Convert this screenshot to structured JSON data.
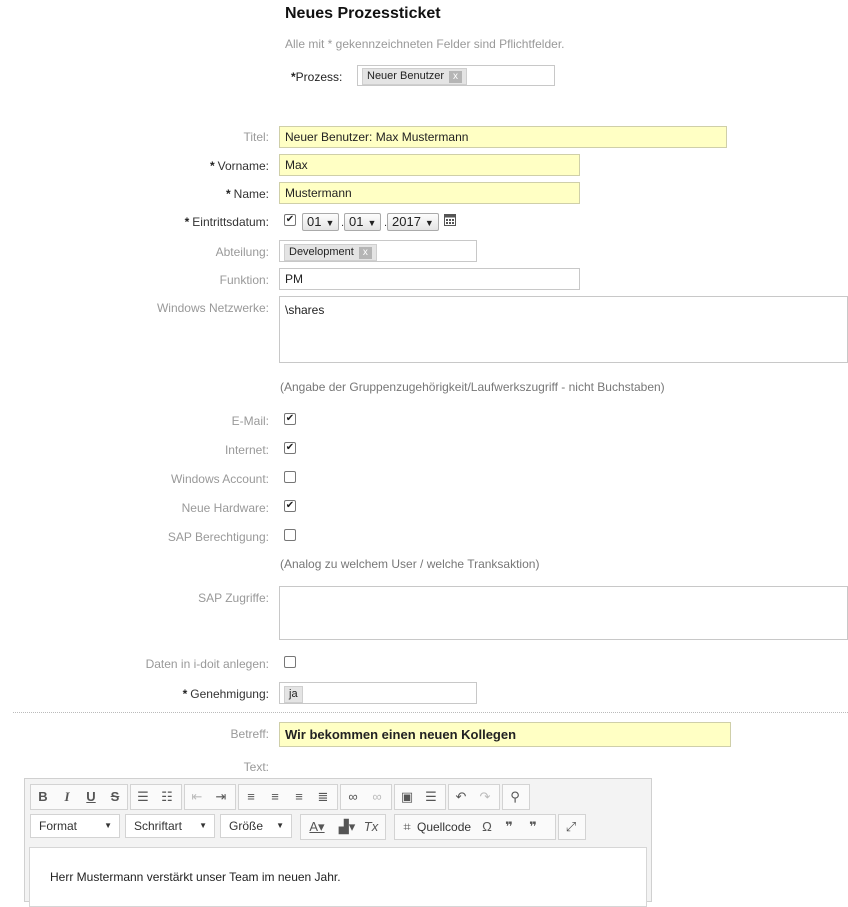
{
  "header": {
    "title": "Neues Prozessticket",
    "hint": "Alle mit * gekennzeichneten Felder sind Pflichtfelder."
  },
  "process": {
    "label": "Prozess:",
    "tag": "Neuer Benutzer",
    "remove": "x"
  },
  "fields": {
    "titel": {
      "label": "Titel:",
      "value": "Neuer Benutzer: Max Mustermann"
    },
    "vorname": {
      "label": "Vorname:",
      "value": "Max"
    },
    "name": {
      "label": "Name:",
      "value": "Mustermann"
    },
    "eintritt": {
      "label": "Eintrittsdatum:",
      "day": "01",
      "month": "01",
      "year": "2017",
      "checked": "✔"
    },
    "abteilung": {
      "label": "Abteilung:",
      "tag": "Development",
      "remove": "x"
    },
    "funktion": {
      "label": "Funktion:",
      "value": "PM"
    },
    "netzwerke": {
      "label": "Windows Netzwerke:",
      "value": "\\shares",
      "hint": "(Angabe der Gruppenzugehörigkeit/Laufwerkszugriff - nicht Buchstaben)"
    },
    "email": {
      "label": "E-Mail:",
      "checked": "✔"
    },
    "internet": {
      "label": "Internet:",
      "checked": "✔"
    },
    "winaccount": {
      "label": "Windows Account:",
      "checked": ""
    },
    "hardware": {
      "label": "Neue Hardware:",
      "checked": "✔"
    },
    "sap": {
      "label": "SAP Berechtigung:",
      "checked": "",
      "hint": "(Analog zu welchem User / welche Tranksaktion)"
    },
    "sapzugriffe": {
      "label": "SAP Zugriffe:",
      "value": ""
    },
    "idoit": {
      "label": "Daten in i-doit anlegen:",
      "checked": ""
    },
    "genehmigung": {
      "label": "Genehmigung:",
      "tag": "ja"
    }
  },
  "mail": {
    "betreff_label": "Betreff:",
    "betreff_value": "Wir bekommen einen neuen Kollegen",
    "text_label": "Text:",
    "body": "Herr Mustermann verstärkt unser Team im neuen Jahr."
  },
  "toolbar": {
    "format": "Format",
    "font": "Schriftart",
    "size": "Größe",
    "source": "Quellcode",
    "bold": "B",
    "italic": "I",
    "underline": "U",
    "strike": "S",
    "omega": "Ω"
  },
  "colors": {
    "required_bg": "#ffffc4",
    "label": "#999999"
  }
}
